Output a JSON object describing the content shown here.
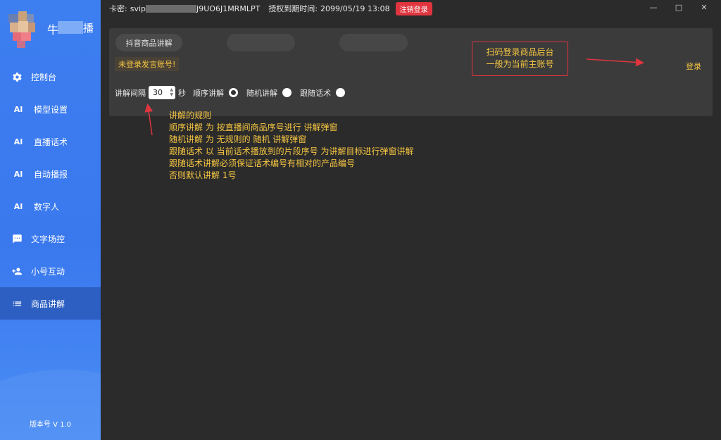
{
  "sidebar": {
    "brand_prefix": "牛",
    "brand_suffix": "播",
    "items": [
      {
        "label": "控制台",
        "icon": "gear-icon"
      },
      {
        "label": "模型设置",
        "icon": "ai-icon"
      },
      {
        "label": "直播话术",
        "icon": "ai-icon"
      },
      {
        "label": "自动播报",
        "icon": "ai-icon"
      },
      {
        "label": "数字人",
        "icon": "ai-icon"
      },
      {
        "label": "文字场控",
        "icon": "chat-icon"
      },
      {
        "label": "小号互动",
        "icon": "add-user-icon"
      },
      {
        "label": "商品讲解",
        "icon": "list-icon",
        "active": true
      }
    ],
    "version": "版本号 V 1.0"
  },
  "titlebar": {
    "card_label": "卡密:",
    "card_prefix": "svip",
    "card_suffix": "J9UO6J1MRMLPT",
    "expiry_label": "授权到期时间:",
    "expiry_value": "2099/05/19 13:08",
    "logout_label": "注销登录"
  },
  "panel": {
    "tabs": [
      "抖音商品讲解",
      "",
      ""
    ],
    "notice": "未登录发言账号!",
    "login_link": "登录",
    "interval_label": "讲解间隔",
    "interval_value": "30",
    "interval_unit": "秒",
    "modes": [
      {
        "label": "顺序讲解",
        "selected": true
      },
      {
        "label": "随机讲解",
        "selected": false
      },
      {
        "label": "跟随话术",
        "selected": false
      }
    ]
  },
  "annotations": {
    "callout_lines": [
      "扫码登录商品后台",
      "一般为当前主账号"
    ],
    "rules_lines": [
      "讲解的规则",
      "顺序讲解 为 按直播间商品序号进行 讲解弹窗",
      "随机讲解 为 无规则的 随机 讲解弹窗",
      "跟随话术 以 当前话术播放到的片段序号 为讲解目标进行弹窗讲解",
      "跟随话术讲解必须保证话术编号有相对的产品编号",
      "否则默认讲解 1号"
    ]
  },
  "colors": {
    "sidebar_blue": "#3d7ef0",
    "active_item": "#2d5fc2",
    "background": "#2b2b2b",
    "panel": "#3b3b3b",
    "accent_yellow": "#f4c542",
    "danger_red": "#e0353f"
  }
}
